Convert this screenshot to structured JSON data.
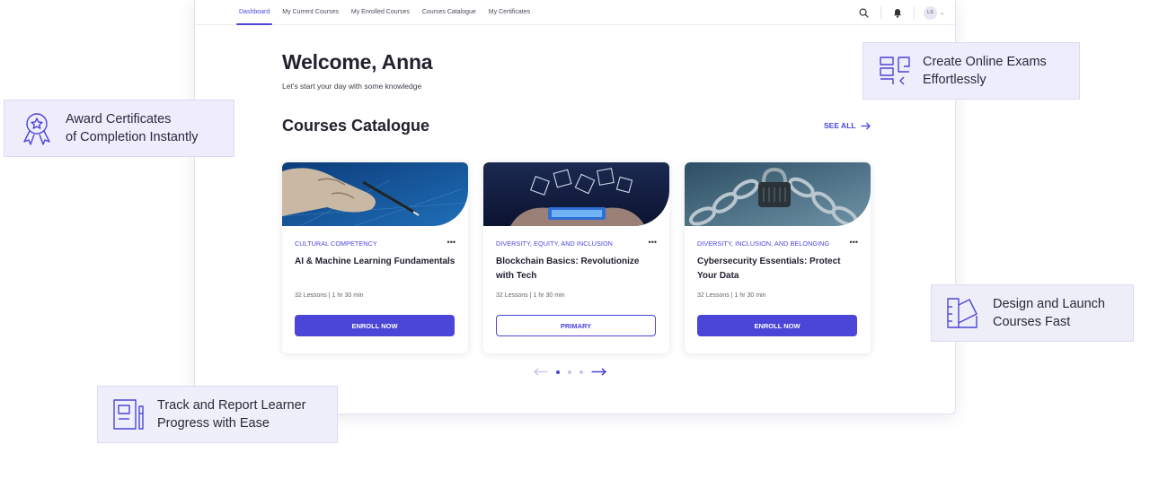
{
  "nav": {
    "links": [
      "Dashboard",
      "My Current Courses",
      "My Enrolled Courses",
      "Courses Catalogue",
      "My Certificates"
    ],
    "active_index": 0,
    "avatar_initials": "LS",
    "icons": [
      "search-icon",
      "bell-icon",
      "chevron-down-icon"
    ]
  },
  "hero": {
    "title": "Welcome, Anna",
    "subtitle": "Let's start your day with some knowledge"
  },
  "catalogue": {
    "title": "Courses Catalogue",
    "see_all": "SEE ALL",
    "cards": [
      {
        "category": "CULTURAL COMPETENCY",
        "title": "AI & Machine Learning Fundamentals",
        "meta": "32 Lessons | 1 hr 30 min",
        "button": "ENROLL NOW",
        "button_style": "solid",
        "image": "robot-hand-writing"
      },
      {
        "category": "DIVERSITY, EQUITY, AND INCLUSION",
        "title": "Blockchain Basics: Revolutionize with Tech",
        "meta": "32 Lessons | 1 hr 30 min",
        "button": "PRIMARY",
        "button_style": "outline",
        "image": "blockchain-phone"
      },
      {
        "category": "DIVERSITY, INCLUSION, AND BELONGING",
        "title": "Cybersecurity Essentials: Protect Your Data",
        "meta": "32 Lessons | 1 hr 30 min",
        "button": "ENROLL NOW",
        "button_style": "solid",
        "image": "chain-padlock"
      }
    ],
    "pager": {
      "pages": 3,
      "current": 1
    }
  },
  "callouts": {
    "award": "Award Certificates of Completion Instantly",
    "award_line1": "Award Certificates",
    "award_line2": "of Completion Instantly",
    "exams_line1": "Create Online Exams",
    "exams_line2": "Effortlessly",
    "design_line1": "Design and Launch",
    "design_line2": "Courses Fast",
    "track_line1": "Track and Report Learner",
    "track_line2": "Progress with Ease"
  },
  "colors": {
    "accent": "#4b45d8",
    "callout_bg": "#eeedfb",
    "text_dark": "#22222e"
  }
}
